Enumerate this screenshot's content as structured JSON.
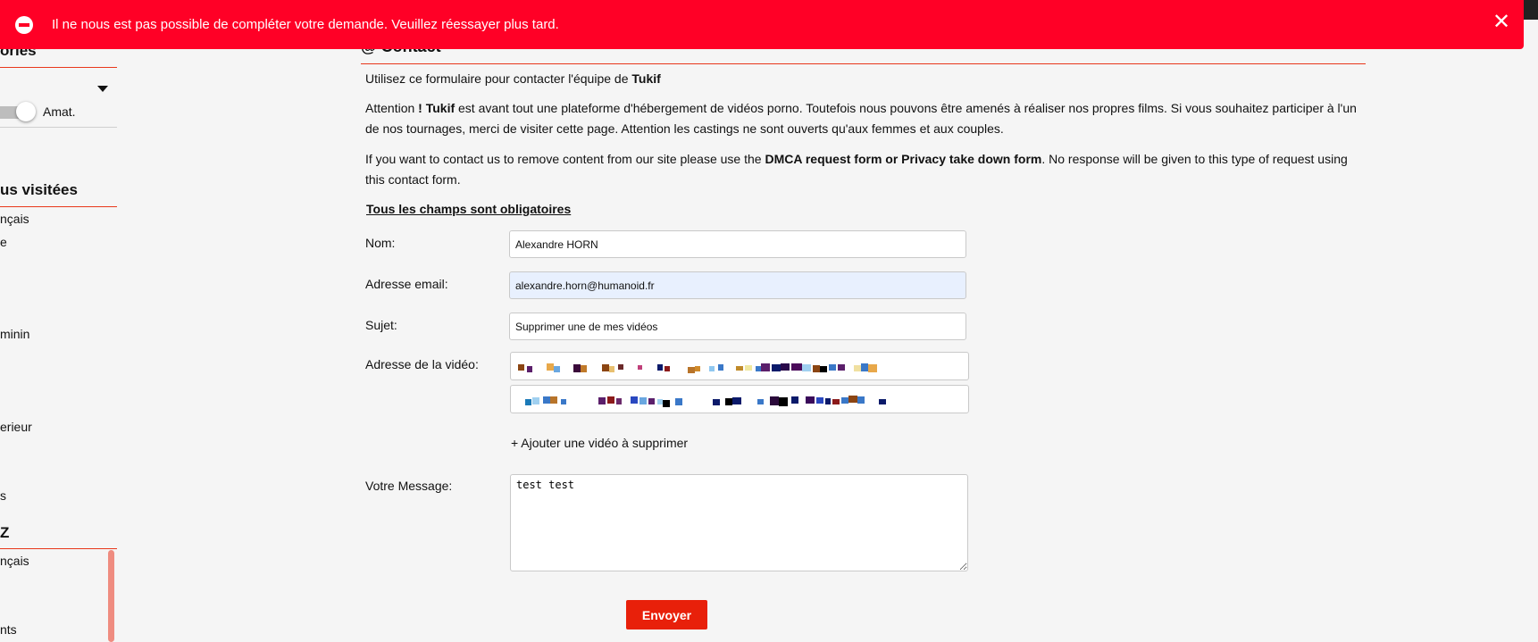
{
  "colors": {
    "accent": "#e8371b",
    "error": "#ff0026",
    "button": "#e8200a"
  },
  "error_banner": {
    "icon": "minus-circle-icon",
    "message": "Il ne nous est pas possible de compléter votre demande. Veuillez réessayer plus tard.",
    "close_glyph": "✕"
  },
  "sidebar": {
    "heading_categories": "ories",
    "toggle_label": "Amat.",
    "heading_most_visited": "us visitées",
    "most_visited_items": [
      "nçais",
      "e",
      "minin",
      "erieur",
      "s"
    ],
    "heading_az": "Z",
    "az_items": [
      "nçais",
      "nts"
    ]
  },
  "main": {
    "title_icon": "@",
    "title": "Contact",
    "intro_prefix": "Utilisez ce formulaire pour contacter l'équipe de ",
    "brand": "Tukif",
    "attention_prefix": "Attention ",
    "attention_bang": "! ",
    "attention_rest": " est avant tout une plateforme d'hébergement de vidéos porno. Toutefois nous pouvons être amenés à réaliser nos propres films. Si vous souhaitez participer à l'un de nos tournages, merci de visiter cette page. Attention les castings ne sont ouverts qu'aux femmes et aux couples.",
    "dmca_prefix": "If you want to contact us to remove content from our site please use the ",
    "dmca_bold": "DMCA request form or Privacy take down form",
    "dmca_suffix": ". No response will be given to this type of request using this contact form.",
    "required_note": "Tous les champs sont obligatoires"
  },
  "form": {
    "name_label": "Nom:",
    "name_value": "Alexandre HORN",
    "email_label": "Adresse email:",
    "email_value": "alexandre.horn@humanoid.fr",
    "subject_label": "Sujet:",
    "subject_value": "Supprimer une de mes vidéos",
    "video_label": "Adresse de la vidéo:",
    "add_video": "+ Ajouter une vidéo à supprimer",
    "message_label": "Votre Message:",
    "message_value": "test test",
    "submit": "Envoyer"
  }
}
